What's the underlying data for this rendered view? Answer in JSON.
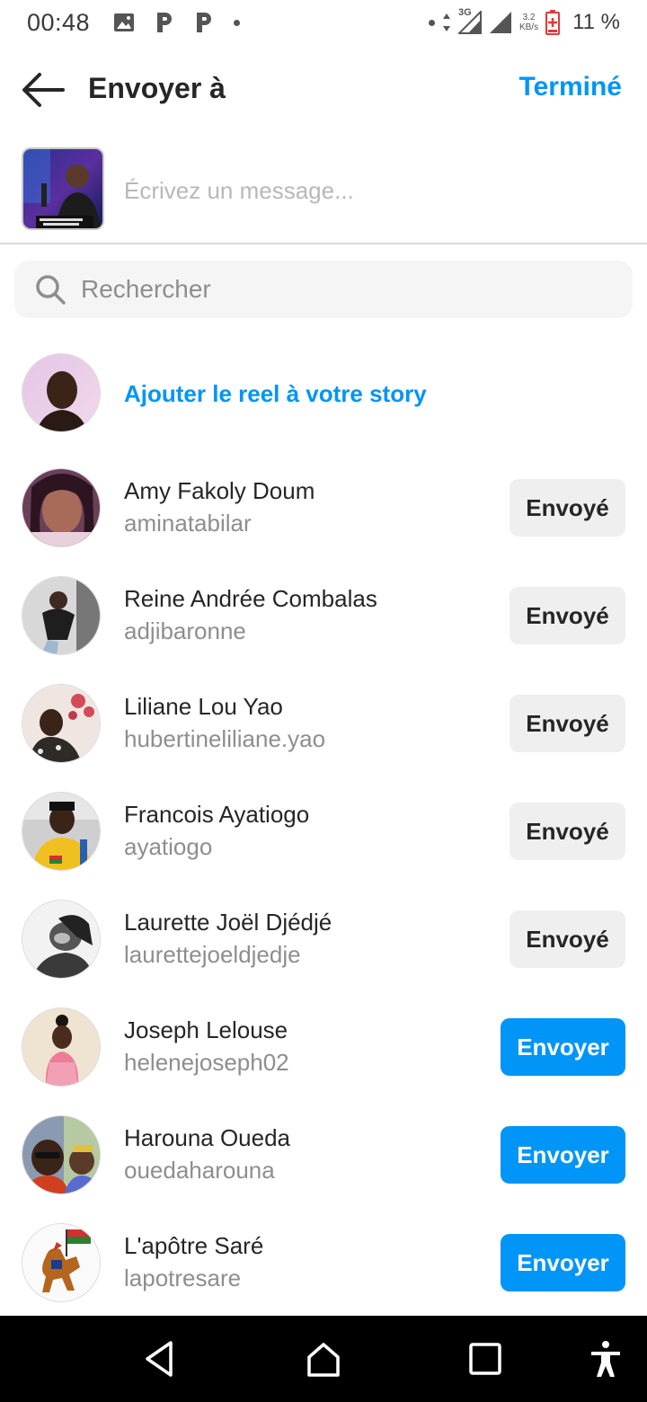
{
  "status_bar": {
    "time": "00:48",
    "network": "3G",
    "speed_value": "3.2",
    "speed_unit": "KB/s",
    "battery": "11 %",
    "notification_icons": [
      "image-icon",
      "p-icon",
      "p-icon",
      "dot-icon"
    ]
  },
  "header": {
    "title": "Envoyer à",
    "done_label": "Terminé"
  },
  "composer": {
    "placeholder": "Écrivez un message..."
  },
  "search": {
    "placeholder": "Rechercher"
  },
  "story": {
    "label": "Ajouter le reel à votre story"
  },
  "contacts": [
    {
      "name": "Amy Fakoly Doum",
      "username": "aminatabilar",
      "button": "Envoyé",
      "state": "sent"
    },
    {
      "name": "Reine Andrée Combalas",
      "username": "adjibaronne",
      "button": "Envoyé",
      "state": "sent"
    },
    {
      "name": "Liliane Lou Yao",
      "username": "hubertineliliane.yao",
      "button": "Envoyé",
      "state": "sent"
    },
    {
      "name": "Francois Ayatiogo",
      "username": "ayatiogo",
      "button": "Envoyé",
      "state": "sent"
    },
    {
      "name": "Laurette Joël Djédjé",
      "username": "laurettejoeldjedje",
      "button": "Envoyé",
      "state": "sent"
    },
    {
      "name": "Joseph Lelouse",
      "username": "helenejoseph02",
      "button": "Envoyer",
      "state": "send"
    },
    {
      "name": "Harouna Oueda",
      "username": "ouedaharouna",
      "button": "Envoyer",
      "state": "send"
    },
    {
      "name": "L'apôtre Saré",
      "username": "lapotresare",
      "button": "Envoyer",
      "state": "send"
    }
  ],
  "colors": {
    "accent": "#0095f6",
    "sent_button_bg": "#efefef",
    "text_primary": "#262626",
    "text_secondary": "#8e8e8e"
  },
  "navbar": {
    "icons": [
      "back-triangle-icon",
      "home-icon",
      "recents-icon",
      "accessibility-icon"
    ]
  }
}
